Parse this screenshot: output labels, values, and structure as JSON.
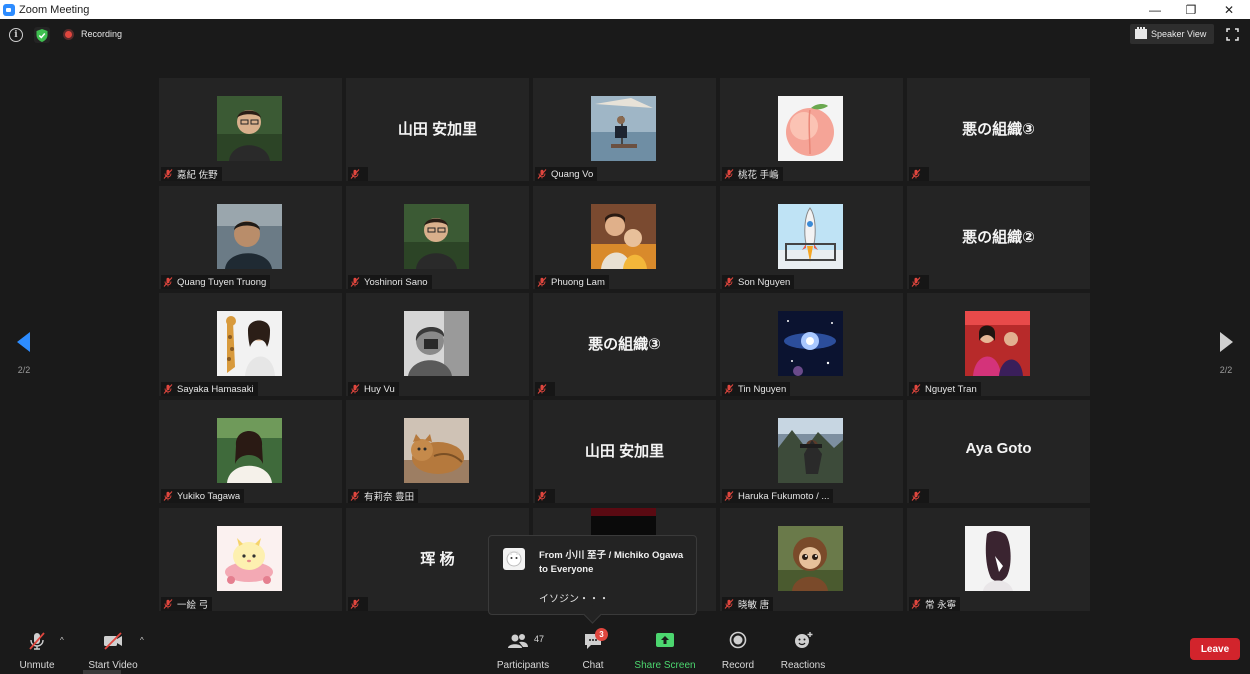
{
  "window": {
    "title": "Zoom Meeting",
    "minimize": "—",
    "restore": "❐",
    "close": "✕"
  },
  "topbar": {
    "info_glyph": "i",
    "recording_label": "Recording",
    "speaker_view_label": "Speaker View"
  },
  "pager": {
    "left": "2/2",
    "right": "2/2"
  },
  "colors": {
    "accent_blue": "#2d8cff",
    "leave_red": "#d2242c",
    "share_green": "#4cd66f",
    "tile_bg": "#242424"
  },
  "tiles": [
    {
      "name": "嘉紀 佐野",
      "display": "",
      "avatar": "photo-man"
    },
    {
      "name": "",
      "display": "山田 安加里",
      "avatar": ""
    },
    {
      "name": "Quang Vo",
      "display": "",
      "avatar": "photo-beach"
    },
    {
      "name": "桃花 手嶋",
      "display": "",
      "avatar": "photo-peach"
    },
    {
      "name": "",
      "display": "悪の組織③",
      "avatar": ""
    },
    {
      "name": "Quang Tuyen Truong",
      "display": "",
      "avatar": "photo-man2"
    },
    {
      "name": "Yoshinori Sano",
      "display": "",
      "avatar": "photo-man"
    },
    {
      "name": "Phuong Lam",
      "display": "",
      "avatar": "photo-family"
    },
    {
      "name": "Son Nguyen",
      "display": "",
      "avatar": "photo-rocket"
    },
    {
      "name": "",
      "display": "悪の組織②",
      "avatar": ""
    },
    {
      "name": "Sayaka Hamasaki",
      "display": "",
      "avatar": "photo-woman-giraffe"
    },
    {
      "name": "Huy Vu",
      "display": "",
      "avatar": "photo-bw"
    },
    {
      "name": "",
      "display": "悪の組織③",
      "avatar": ""
    },
    {
      "name": "Tin Nguyen",
      "display": "",
      "avatar": "photo-space"
    },
    {
      "name": "Nguyet Tran",
      "display": "",
      "avatar": "photo-red"
    },
    {
      "name": "Yukiko Tagawa",
      "display": "",
      "avatar": "photo-woman"
    },
    {
      "name": "有莉奈 豊田",
      "display": "",
      "avatar": "photo-cat"
    },
    {
      "name": "",
      "display": "山田 安加里",
      "avatar": ""
    },
    {
      "name": "Haruka Fukumoto / ...",
      "display": "",
      "avatar": "photo-forest"
    },
    {
      "name": "",
      "display": "Aya Goto",
      "avatar": ""
    },
    {
      "name": "一絵 弓",
      "display": "",
      "avatar": "photo-cartoon"
    },
    {
      "name": "",
      "display": "珲 杨",
      "avatar": ""
    },
    {
      "name": "",
      "display": "",
      "avatar": "photo-dark"
    },
    {
      "name": "晓敏 唐",
      "display": "",
      "avatar": "photo-doll"
    },
    {
      "name": "常 永寧",
      "display": "",
      "avatar": "photo-hair"
    }
  ],
  "chat_popup": {
    "from": "From 小川 至子 / Michiko Ogawa to Everyone",
    "message": "イソジン・・・"
  },
  "toolbar": {
    "unmute": "Unmute",
    "start_video": "Start Video",
    "participants": "Participants",
    "participants_count": "47",
    "chat": "Chat",
    "chat_badge": "3",
    "share_screen": "Share Screen",
    "record": "Record",
    "reactions": "Reactions",
    "leave": "Leave"
  }
}
